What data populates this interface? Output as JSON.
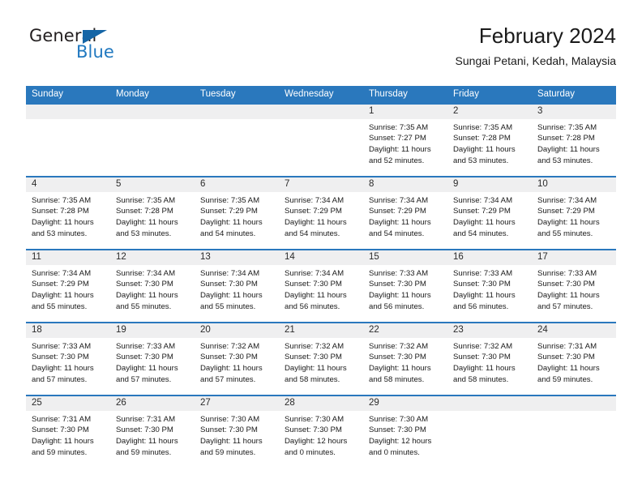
{
  "brand": {
    "name_part1": "General",
    "name_part2": "Blue",
    "triangle_color": "#1565a6",
    "blue_color": "#2179c0"
  },
  "header": {
    "title": "February 2024",
    "subtitle": "Sungai Petani, Kedah, Malaysia"
  },
  "theme": {
    "header_blue": "#2a78bd",
    "daynum_band": "#efeff0",
    "text": "#1a1a1a"
  },
  "weekdays": [
    "Sunday",
    "Monday",
    "Tuesday",
    "Wednesday",
    "Thursday",
    "Friday",
    "Saturday"
  ],
  "weeks": [
    [
      {
        "day": "",
        "sunrise": "",
        "sunset": "",
        "daylight_line1": "",
        "daylight_line2": ""
      },
      {
        "day": "",
        "sunrise": "",
        "sunset": "",
        "daylight_line1": "",
        "daylight_line2": ""
      },
      {
        "day": "",
        "sunrise": "",
        "sunset": "",
        "daylight_line1": "",
        "daylight_line2": ""
      },
      {
        "day": "",
        "sunrise": "",
        "sunset": "",
        "daylight_line1": "",
        "daylight_line2": ""
      },
      {
        "day": "1",
        "sunrise": "Sunrise: 7:35 AM",
        "sunset": "Sunset: 7:27 PM",
        "daylight_line1": "Daylight: 11 hours",
        "daylight_line2": "and 52 minutes."
      },
      {
        "day": "2",
        "sunrise": "Sunrise: 7:35 AM",
        "sunset": "Sunset: 7:28 PM",
        "daylight_line1": "Daylight: 11 hours",
        "daylight_line2": "and 53 minutes."
      },
      {
        "day": "3",
        "sunrise": "Sunrise: 7:35 AM",
        "sunset": "Sunset: 7:28 PM",
        "daylight_line1": "Daylight: 11 hours",
        "daylight_line2": "and 53 minutes."
      }
    ],
    [
      {
        "day": "4",
        "sunrise": "Sunrise: 7:35 AM",
        "sunset": "Sunset: 7:28 PM",
        "daylight_line1": "Daylight: 11 hours",
        "daylight_line2": "and 53 minutes."
      },
      {
        "day": "5",
        "sunrise": "Sunrise: 7:35 AM",
        "sunset": "Sunset: 7:28 PM",
        "daylight_line1": "Daylight: 11 hours",
        "daylight_line2": "and 53 minutes."
      },
      {
        "day": "6",
        "sunrise": "Sunrise: 7:35 AM",
        "sunset": "Sunset: 7:29 PM",
        "daylight_line1": "Daylight: 11 hours",
        "daylight_line2": "and 54 minutes."
      },
      {
        "day": "7",
        "sunrise": "Sunrise: 7:34 AM",
        "sunset": "Sunset: 7:29 PM",
        "daylight_line1": "Daylight: 11 hours",
        "daylight_line2": "and 54 minutes."
      },
      {
        "day": "8",
        "sunrise": "Sunrise: 7:34 AM",
        "sunset": "Sunset: 7:29 PM",
        "daylight_line1": "Daylight: 11 hours",
        "daylight_line2": "and 54 minutes."
      },
      {
        "day": "9",
        "sunrise": "Sunrise: 7:34 AM",
        "sunset": "Sunset: 7:29 PM",
        "daylight_line1": "Daylight: 11 hours",
        "daylight_line2": "and 54 minutes."
      },
      {
        "day": "10",
        "sunrise": "Sunrise: 7:34 AM",
        "sunset": "Sunset: 7:29 PM",
        "daylight_line1": "Daylight: 11 hours",
        "daylight_line2": "and 55 minutes."
      }
    ],
    [
      {
        "day": "11",
        "sunrise": "Sunrise: 7:34 AM",
        "sunset": "Sunset: 7:29 PM",
        "daylight_line1": "Daylight: 11 hours",
        "daylight_line2": "and 55 minutes."
      },
      {
        "day": "12",
        "sunrise": "Sunrise: 7:34 AM",
        "sunset": "Sunset: 7:30 PM",
        "daylight_line1": "Daylight: 11 hours",
        "daylight_line2": "and 55 minutes."
      },
      {
        "day": "13",
        "sunrise": "Sunrise: 7:34 AM",
        "sunset": "Sunset: 7:30 PM",
        "daylight_line1": "Daylight: 11 hours",
        "daylight_line2": "and 55 minutes."
      },
      {
        "day": "14",
        "sunrise": "Sunrise: 7:34 AM",
        "sunset": "Sunset: 7:30 PM",
        "daylight_line1": "Daylight: 11 hours",
        "daylight_line2": "and 56 minutes."
      },
      {
        "day": "15",
        "sunrise": "Sunrise: 7:33 AM",
        "sunset": "Sunset: 7:30 PM",
        "daylight_line1": "Daylight: 11 hours",
        "daylight_line2": "and 56 minutes."
      },
      {
        "day": "16",
        "sunrise": "Sunrise: 7:33 AM",
        "sunset": "Sunset: 7:30 PM",
        "daylight_line1": "Daylight: 11 hours",
        "daylight_line2": "and 56 minutes."
      },
      {
        "day": "17",
        "sunrise": "Sunrise: 7:33 AM",
        "sunset": "Sunset: 7:30 PM",
        "daylight_line1": "Daylight: 11 hours",
        "daylight_line2": "and 57 minutes."
      }
    ],
    [
      {
        "day": "18",
        "sunrise": "Sunrise: 7:33 AM",
        "sunset": "Sunset: 7:30 PM",
        "daylight_line1": "Daylight: 11 hours",
        "daylight_line2": "and 57 minutes."
      },
      {
        "day": "19",
        "sunrise": "Sunrise: 7:33 AM",
        "sunset": "Sunset: 7:30 PM",
        "daylight_line1": "Daylight: 11 hours",
        "daylight_line2": "and 57 minutes."
      },
      {
        "day": "20",
        "sunrise": "Sunrise: 7:32 AM",
        "sunset": "Sunset: 7:30 PM",
        "daylight_line1": "Daylight: 11 hours",
        "daylight_line2": "and 57 minutes."
      },
      {
        "day": "21",
        "sunrise": "Sunrise: 7:32 AM",
        "sunset": "Sunset: 7:30 PM",
        "daylight_line1": "Daylight: 11 hours",
        "daylight_line2": "and 58 minutes."
      },
      {
        "day": "22",
        "sunrise": "Sunrise: 7:32 AM",
        "sunset": "Sunset: 7:30 PM",
        "daylight_line1": "Daylight: 11 hours",
        "daylight_line2": "and 58 minutes."
      },
      {
        "day": "23",
        "sunrise": "Sunrise: 7:32 AM",
        "sunset": "Sunset: 7:30 PM",
        "daylight_line1": "Daylight: 11 hours",
        "daylight_line2": "and 58 minutes."
      },
      {
        "day": "24",
        "sunrise": "Sunrise: 7:31 AM",
        "sunset": "Sunset: 7:30 PM",
        "daylight_line1": "Daylight: 11 hours",
        "daylight_line2": "and 59 minutes."
      }
    ],
    [
      {
        "day": "25",
        "sunrise": "Sunrise: 7:31 AM",
        "sunset": "Sunset: 7:30 PM",
        "daylight_line1": "Daylight: 11 hours",
        "daylight_line2": "and 59 minutes."
      },
      {
        "day": "26",
        "sunrise": "Sunrise: 7:31 AM",
        "sunset": "Sunset: 7:30 PM",
        "daylight_line1": "Daylight: 11 hours",
        "daylight_line2": "and 59 minutes."
      },
      {
        "day": "27",
        "sunrise": "Sunrise: 7:30 AM",
        "sunset": "Sunset: 7:30 PM",
        "daylight_line1": "Daylight: 11 hours",
        "daylight_line2": "and 59 minutes."
      },
      {
        "day": "28",
        "sunrise": "Sunrise: 7:30 AM",
        "sunset": "Sunset: 7:30 PM",
        "daylight_line1": "Daylight: 12 hours",
        "daylight_line2": "and 0 minutes."
      },
      {
        "day": "29",
        "sunrise": "Sunrise: 7:30 AM",
        "sunset": "Sunset: 7:30 PM",
        "daylight_line1": "Daylight: 12 hours",
        "daylight_line2": "and 0 minutes."
      },
      {
        "day": "",
        "sunrise": "",
        "sunset": "",
        "daylight_line1": "",
        "daylight_line2": ""
      },
      {
        "day": "",
        "sunrise": "",
        "sunset": "",
        "daylight_line1": "",
        "daylight_line2": ""
      }
    ]
  ]
}
